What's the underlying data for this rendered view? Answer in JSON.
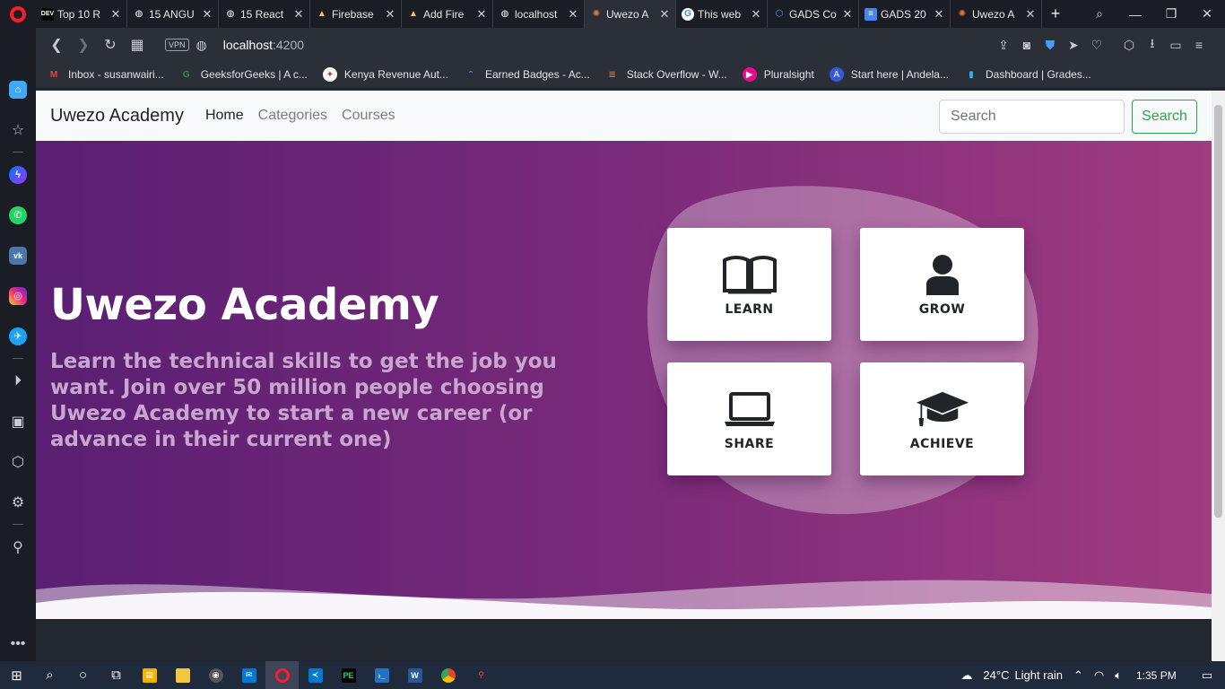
{
  "browser": {
    "tabs": [
      {
        "title": "Top 10 R",
        "icon": "dev-icon",
        "active": false
      },
      {
        "title": "15 ANGU",
        "icon": "globe-icon",
        "active": false
      },
      {
        "title": "15 React",
        "icon": "globe-icon",
        "active": false
      },
      {
        "title": "Firebase",
        "icon": "firebase-icon",
        "active": false
      },
      {
        "title": "Add Fire",
        "icon": "firebase-icon",
        "active": false
      },
      {
        "title": "localhost",
        "icon": "globe-icon",
        "active": false
      },
      {
        "title": "Uwezo A",
        "icon": "uwezo-icon",
        "active": true
      },
      {
        "title": "This web",
        "icon": "google-icon",
        "active": false
      },
      {
        "title": "GADS Co",
        "icon": "gads-icon",
        "active": false
      },
      {
        "title": "GADS 20",
        "icon": "docs-icon",
        "active": false
      },
      {
        "title": "Uwezo A",
        "icon": "uwezo-icon",
        "active": false
      }
    ],
    "url_host": "localhost",
    "url_port": ":4200",
    "vpn_label": "VPN",
    "bookmarks": [
      {
        "label": "Inbox - susanwairi...",
        "icon": "gmail-icon",
        "color": "#ea4335"
      },
      {
        "label": "GeeksforGeeks | A c...",
        "icon": "gfg-icon",
        "color": "#2f8d46"
      },
      {
        "label": "Kenya Revenue Aut...",
        "icon": "kra-icon",
        "color": "#c0392b"
      },
      {
        "label": "Earned Badges - Ac...",
        "icon": "badge-icon",
        "color": "#4a90e2"
      },
      {
        "label": "Stack Overflow - W...",
        "icon": "stackoverflow-icon",
        "color": "#f48024"
      },
      {
        "label": "Pluralsight",
        "icon": "pluralsight-icon",
        "color": "#e80a89"
      },
      {
        "label": "Start here | Andela...",
        "icon": "andela-icon",
        "color": "#3359df"
      },
      {
        "label": "Dashboard | Grades...",
        "icon": "chart-icon",
        "color": "#29b6f6"
      }
    ]
  },
  "site": {
    "brand": "Uwezo Academy",
    "nav": [
      {
        "label": "Home",
        "active": true
      },
      {
        "label": "Categories",
        "active": false
      },
      {
        "label": "Courses",
        "active": false
      }
    ],
    "search_placeholder": "Search",
    "search_button": "Search"
  },
  "hero": {
    "title": "Uwezo Academy",
    "text": "Learn the technical skills to get the job you want. Join over 50 million people choosing Uwezo Academy to start a new career (or advance in their current one)",
    "cards": [
      {
        "label": "LEARN",
        "icon": "book-icon"
      },
      {
        "label": "GROW",
        "icon": "user-icon"
      },
      {
        "label": "SHARE",
        "icon": "laptop-icon"
      },
      {
        "label": "ACHIEVE",
        "icon": "graduation-cap-icon"
      }
    ]
  },
  "taskbar": {
    "weather": "24°C",
    "weather_desc": "Light rain",
    "time": "1:35 PM"
  }
}
